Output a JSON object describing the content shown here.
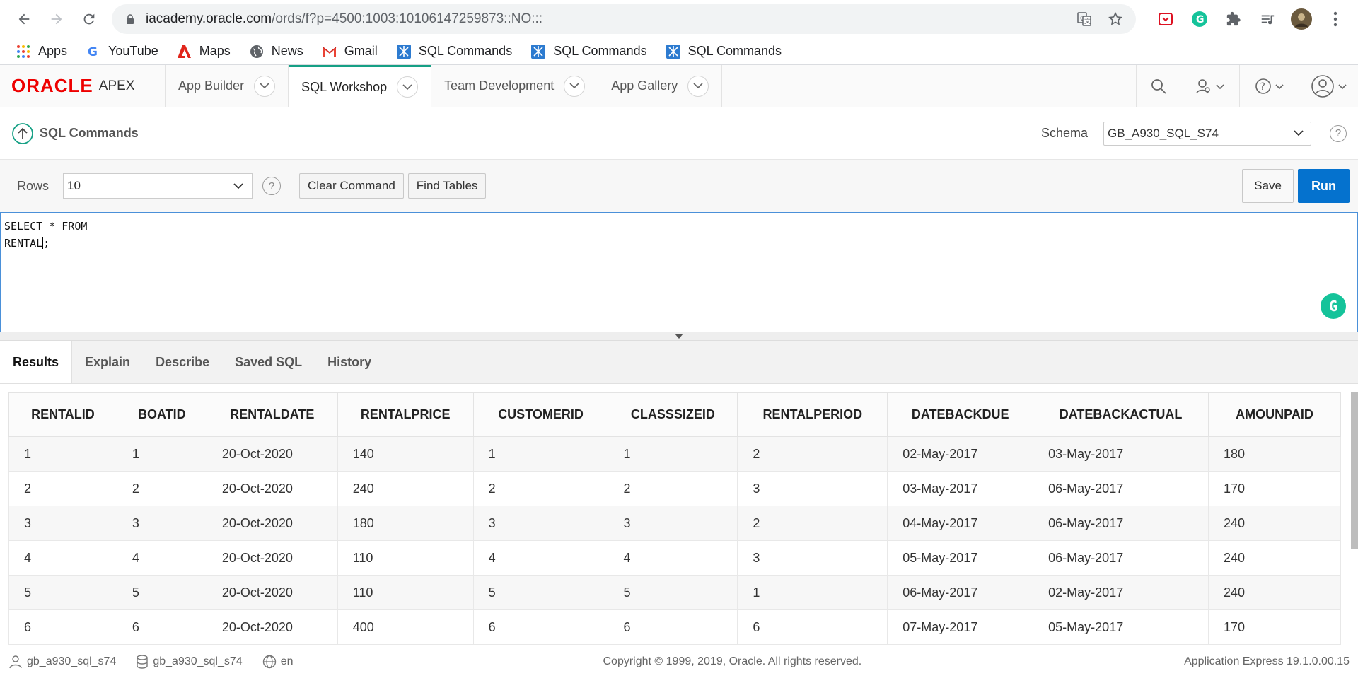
{
  "browser": {
    "url_host": "iacademy.oracle.com",
    "url_path": "/ords/f?p=4500:1003:10106147259873::NO:::",
    "bookmarks": [
      {
        "label": "Apps",
        "icon": "apps-grid-icon"
      },
      {
        "label": "YouTube",
        "icon": "google-icon"
      },
      {
        "label": "Maps",
        "icon": "adobe-icon"
      },
      {
        "label": "News",
        "icon": "globe-icon"
      },
      {
        "label": "Gmail",
        "icon": "gmail-icon"
      },
      {
        "label": "SQL Commands",
        "icon": "apex-icon"
      },
      {
        "label": "SQL Commands",
        "icon": "apex-icon"
      },
      {
        "label": "SQL Commands",
        "icon": "apex-icon"
      }
    ]
  },
  "apex": {
    "logo_oracle": "ORACLE",
    "logo_apex": "APEX",
    "tabs": [
      {
        "label": "App Builder"
      },
      {
        "label": "SQL Workshop"
      },
      {
        "label": "Team Development"
      },
      {
        "label": "App Gallery"
      }
    ]
  },
  "page": {
    "title": "SQL Commands",
    "schema_label": "Schema",
    "schema_value": "GB_A930_SQL_S74"
  },
  "toolbar": {
    "rows_label": "Rows",
    "rows_value": "10",
    "clear_label": "Clear Command",
    "find_label": "Find Tables",
    "save_label": "Save",
    "run_label": "Run"
  },
  "editor": {
    "line1": "SELECT * FROM",
    "line2_before_cursor": "RENTAL",
    "line2_after_cursor": ";"
  },
  "result_tabs": [
    "Results",
    "Explain",
    "Describe",
    "Saved SQL",
    "History"
  ],
  "table": {
    "columns": [
      "RENTALID",
      "BOATID",
      "RENTALDATE",
      "RENTALPRICE",
      "CUSTOMERID",
      "CLASSSIZEID",
      "RENTALPERIOD",
      "DATEBACKDUE",
      "DATEBACKACTUAL",
      "AMOUNPAID"
    ],
    "rows": [
      [
        "1",
        "1",
        "20-Oct-2020",
        "140",
        "1",
        "1",
        "2",
        "02-May-2017",
        "03-May-2017",
        "180"
      ],
      [
        "2",
        "2",
        "20-Oct-2020",
        "240",
        "2",
        "2",
        "3",
        "03-May-2017",
        "06-May-2017",
        "170"
      ],
      [
        "3",
        "3",
        "20-Oct-2020",
        "180",
        "3",
        "3",
        "2",
        "04-May-2017",
        "06-May-2017",
        "240"
      ],
      [
        "4",
        "4",
        "20-Oct-2020",
        "110",
        "4",
        "4",
        "3",
        "05-May-2017",
        "06-May-2017",
        "240"
      ],
      [
        "5",
        "5",
        "20-Oct-2020",
        "110",
        "5",
        "5",
        "1",
        "06-May-2017",
        "02-May-2017",
        "240"
      ],
      [
        "6",
        "6",
        "20-Oct-2020",
        "400",
        "6",
        "6",
        "6",
        "07-May-2017",
        "05-May-2017",
        "170"
      ]
    ]
  },
  "footer": {
    "user": "gb_a930_sql_s74",
    "schema": "gb_a930_sql_s74",
    "language": "en",
    "copyright": "Copyright © 1999, 2019, Oracle. All rights reserved.",
    "version": "Application Express 19.1.0.00.15"
  },
  "colors": {
    "run_button": "#0572ce",
    "active_tab_accent": "#16a085",
    "oracle_red": "#ee0000",
    "grammarly": "#15c39a"
  }
}
